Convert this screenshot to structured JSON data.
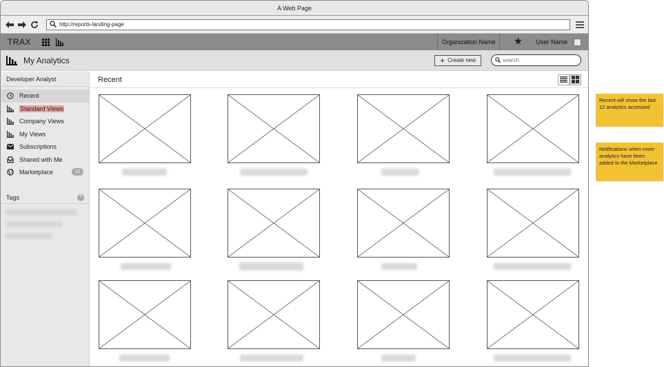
{
  "window": {
    "title": "A Web Page"
  },
  "url": {
    "value": "http://reports-landing-page"
  },
  "appbar": {
    "brand": "TRAX",
    "org_name": "Organization Name",
    "user_name": "User Name"
  },
  "subbar": {
    "title": "My Analytics",
    "create_label": "Create new",
    "search_placeholder": "search"
  },
  "sidebar": {
    "role": "Developer Analyst",
    "items": [
      {
        "label": "Recent",
        "icon": "clock-icon",
        "active": true
      },
      {
        "label": "Standard Views",
        "icon": "bar-chart-icon",
        "highlight": true
      },
      {
        "label": "Company Views",
        "icon": "bar-chart-icon"
      },
      {
        "label": "My Views",
        "icon": "bar-chart-icon"
      },
      {
        "label": "Subscriptions",
        "icon": "envelope-icon"
      },
      {
        "label": "Shared with Me",
        "icon": "inbox-icon"
      },
      {
        "label": "Marketplace",
        "icon": "globe-icon",
        "badge": "12"
      }
    ],
    "tags_label": "Tags",
    "tags_help": "?"
  },
  "main": {
    "title": "Recent",
    "tile_count": 12
  },
  "notes": [
    {
      "text": "Recent will show the last 12 analytics accessed"
    },
    {
      "text": "Notifications when more analytics have been added to the Marketplace"
    }
  ],
  "colors": {
    "appbar": "#8c8c8c",
    "note": "#f3c233",
    "highlight": "#e9a4a4"
  }
}
